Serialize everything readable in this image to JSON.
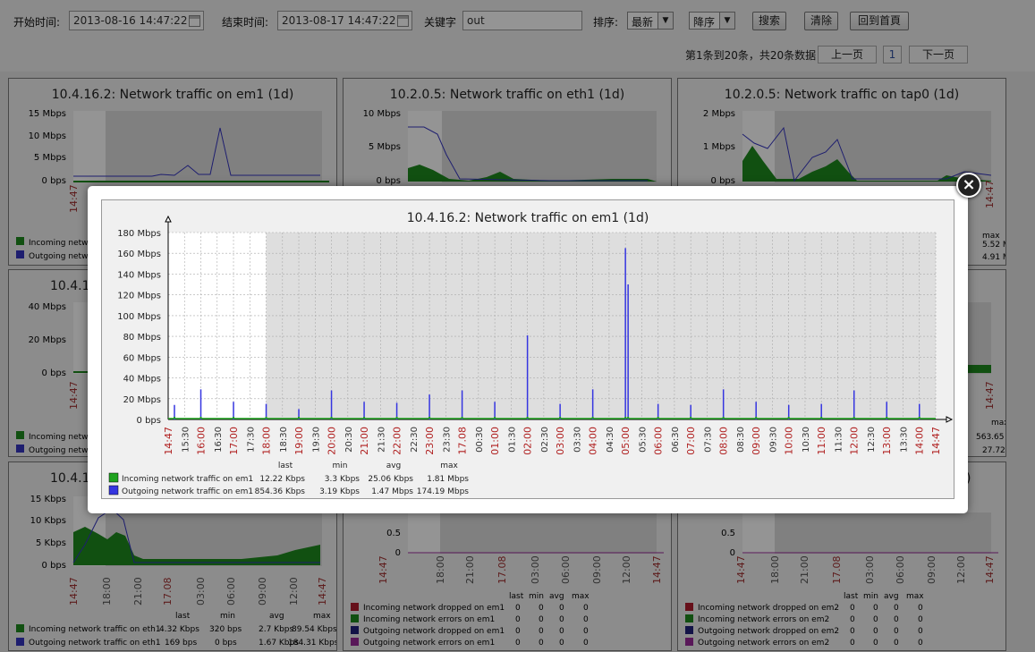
{
  "toolbar": {
    "start_label": "开始时间:",
    "start_value": "2013-08-16 14:47:22",
    "end_label": "结束时间:",
    "end_value": "2013-08-17 14:47:22",
    "keyword_label": "关键字",
    "keyword_value": "out",
    "sort_label": "排序:",
    "sort_value": "最新",
    "order_value": "降序",
    "search_btn": "搜索",
    "clear_btn": "清除",
    "home_btn": "回到首頁"
  },
  "pager": {
    "info": "第1条到20条，共20条数据",
    "prev": "上一页",
    "page": "1",
    "next": "下一页"
  },
  "panels": {
    "p1_title": "10.4.16.2: Network traffic on em1 (1d)",
    "p2_title": "10.2.0.5: Network traffic on eth1 (1d)",
    "p3_title": "10.2.0.5: Network traffic on tap0 (1d)",
    "p4_title": "10.4.1",
    "p7_title": "10.4.1",
    "p1_y": [
      "15 Mbps",
      "10 Mbps",
      "5 Mbps",
      "0 bps"
    ],
    "p2_y": [
      "10 Mbps",
      "5 Mbps",
      "0 bps"
    ],
    "p3_y": [
      "2 Mbps",
      "1 Mbps",
      "0 bps"
    ],
    "p4_y": [
      "40 Mbps",
      "20 Mbps",
      "0 bps"
    ],
    "p7_y": [
      "15 Kbps",
      "10 Kbps",
      "5 Kbps",
      "0 bps"
    ],
    "p8_y": [
      "0.5",
      "0"
    ],
    "p9_y": [
      "0.5",
      "0"
    ],
    "p1_legend": [
      "Incoming netw",
      "Outgoing netw"
    ],
    "p4_legend": [
      "Incoming netw",
      "Outgoing netw"
    ],
    "p3_right": [
      "max",
      "5.52 M",
      "4.91 M"
    ],
    "p6_right": [
      "max",
      "563.65",
      "27.72"
    ],
    "p9_title_frag": ")",
    "p7_x": [
      "14:47",
      "18:00",
      "21:00",
      "17.08",
      "03:00",
      "06:00",
      "09:00",
      "12:00",
      "14:47"
    ],
    "p8_x": [
      "14:47",
      "18:00",
      "21:00",
      "17.08",
      "03:00",
      "06:00",
      "09:00",
      "12:00",
      "14:47"
    ],
    "p9_x": [
      "14:47",
      "18:00",
      "21:00",
      "17.08",
      "03:00",
      "06:00",
      "09:00",
      "12:00",
      "14:47"
    ],
    "p7_legend_head": [
      "last",
      "min",
      "avg",
      "max"
    ],
    "p7_legend": [
      {
        "name": "Incoming network traffic on eth1",
        "last": "4.32 Kbps",
        "min": "320 bps",
        "avg": "2.7 Kbps",
        "max": "89.54 Kbps",
        "color": "#1e8a1e"
      },
      {
        "name": "Outgoing network traffic on eth1",
        "last": "169 bps",
        "min": "0 bps",
        "avg": "1.67 Kbps",
        "max": "184.31 Kbps",
        "color": "#3b3bcc"
      }
    ],
    "p8_legend_head": [
      "last",
      "min",
      "avg",
      "max"
    ],
    "p8_legend": [
      {
        "name": "Incoming network dropped on em1",
        "v": [
          "0",
          "0",
          "0",
          "0"
        ],
        "color": "#b01c2e"
      },
      {
        "name": "Incoming network errors on em1",
        "v": [
          "0",
          "0",
          "0",
          "0"
        ],
        "color": "#1e8a1e"
      },
      {
        "name": "Outgoing network dropped on em1",
        "v": [
          "0",
          "0",
          "0",
          "0"
        ],
        "color": "#22227a"
      },
      {
        "name": "Outgoing network errors on em1",
        "v": [
          "0",
          "0",
          "0",
          "0"
        ],
        "color": "#9a2a9a"
      }
    ],
    "p9_legend": [
      {
        "name": "Incoming network dropped on em2",
        "v": [
          "0",
          "0",
          "0",
          "0"
        ],
        "color": "#b01c2e"
      },
      {
        "name": "Incoming network errors on em2",
        "v": [
          "0",
          "0",
          "0",
          "0"
        ],
        "color": "#1e8a1e"
      },
      {
        "name": "Outgoing network dropped on em2",
        "v": [
          "0",
          "0",
          "0",
          "0"
        ],
        "color": "#22227a"
      },
      {
        "name": "Outgoing network errors on em2",
        "v": [
          "0",
          "0",
          "0",
          "0"
        ],
        "color": "#9a2a9a"
      }
    ],
    "side_time": "14:47"
  },
  "modal": {
    "close_label": "×"
  },
  "chart_data": {
    "type": "line",
    "title": "10.4.16.2: Network traffic on em1 (1d)",
    "ylabel": "",
    "ylim": [
      0,
      180
    ],
    "y_ticks": [
      "180 Mbps",
      "160 Mbps",
      "140 Mbps",
      "120 Mbps",
      "100 Mbps",
      "80 Mbps",
      "60 Mbps",
      "40 Mbps",
      "20 Mbps",
      "0 bps"
    ],
    "x_ticks": [
      "14:47",
      "15:30",
      "16:00",
      "16:30",
      "17:00",
      "17:30",
      "18:00",
      "18:30",
      "19:00",
      "19:30",
      "20:00",
      "20:30",
      "21:00",
      "21:30",
      "22:00",
      "22:30",
      "23:00",
      "23:30",
      "17.08",
      "00:30",
      "01:00",
      "01:30",
      "02:00",
      "02:30",
      "03:00",
      "03:30",
      "04:00",
      "04:30",
      "05:00",
      "05:30",
      "06:00",
      "06:30",
      "07:00",
      "07:30",
      "08:00",
      "08:30",
      "09:00",
      "09:30",
      "10:00",
      "10:30",
      "11:00",
      "11:30",
      "12:00",
      "12:30",
      "13:00",
      "13:30",
      "14:00",
      "14:47"
    ],
    "red_ticks": [
      "14:47",
      "16:00",
      "17:00",
      "18:00",
      "19:00",
      "20:00",
      "21:00",
      "22:00",
      "23:00",
      "17.08",
      "01:00",
      "02:00",
      "03:00",
      "04:00",
      "05:00",
      "06:00",
      "07:00",
      "08:00",
      "09:00",
      "10:00",
      "11:00",
      "12:00",
      "13:00",
      "14:00"
    ],
    "series": [
      {
        "name": "Incoming network traffic on em1",
        "color": "#1ea31e",
        "last": "12.22 Kbps",
        "min": "3.3 Kbps",
        "avg": "25.06 Kbps",
        "max": "1.81 Mbps"
      },
      {
        "name": "Outgoing network traffic on em1",
        "color": "#3535e0",
        "last": "854.36 Kbps",
        "min": "3.19 Kbps",
        "avg": "1.47 Mbps",
        "max": "174.19 Mbps",
        "spikes": [
          [
            "14:53",
            14
          ],
          [
            "16:00",
            29
          ],
          [
            "17:00",
            17
          ],
          [
            "18:00",
            15
          ],
          [
            "19:00",
            10
          ],
          [
            "20:00",
            28
          ],
          [
            "21:00",
            17
          ],
          [
            "22:00",
            16
          ],
          [
            "23:00",
            24
          ],
          [
            "17.08",
            28
          ],
          [
            "01:00",
            17
          ],
          [
            "02:00",
            81
          ],
          [
            "03:00",
            15
          ],
          [
            "04:00",
            29
          ],
          [
            "05:00",
            165
          ],
          [
            "05:05",
            130
          ],
          [
            "06:00",
            15
          ],
          [
            "07:00",
            14
          ],
          [
            "08:00",
            29
          ],
          [
            "09:00",
            17
          ],
          [
            "10:00",
            14
          ],
          [
            "11:00",
            15
          ],
          [
            "12:00",
            28
          ],
          [
            "13:00",
            17
          ],
          [
            "14:00",
            15
          ]
        ]
      }
    ],
    "legend_head": [
      "last",
      "min",
      "avg",
      "max"
    ],
    "grid": true
  }
}
